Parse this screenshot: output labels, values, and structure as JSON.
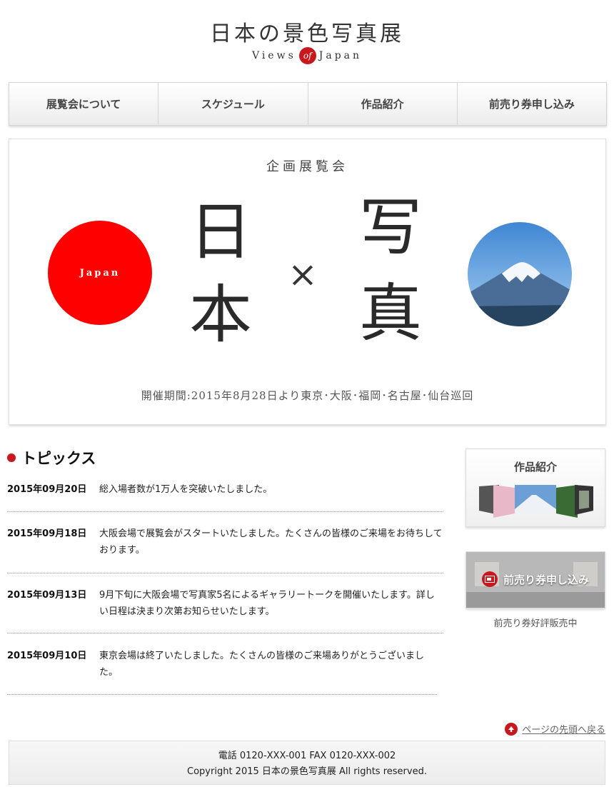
{
  "header": {
    "title": "日本の景色写真展",
    "subtitle_left": "Views",
    "subtitle_of": "of",
    "subtitle_right": "Japan"
  },
  "nav": {
    "items": [
      "展覧会について",
      "スケジュール",
      "作品紹介",
      "前売り券申し込み"
    ]
  },
  "hero": {
    "kicker": "企画展覧会",
    "circle_label": "Japan",
    "char1": "日",
    "char2": "本",
    "times": "×",
    "char3": "写",
    "char4": "真",
    "period": "開催期間:2015年8月28日より東京･大阪･福岡･名古屋･仙台巡回",
    "accent_color": "#ff0000"
  },
  "topics": {
    "title": "トピックス",
    "items": [
      {
        "date": "2015年09月20日",
        "text": "総入場者数が1万人を突破いたしました。"
      },
      {
        "date": "2015年09月18日",
        "text": "大阪会場で展覧会がスタートいたしました。たくさんの皆様のご来場をお待ちしております。"
      },
      {
        "date": "2015年09月13日",
        "text": "9月下旬に大阪会場で写真家5名によるギャラリートークを開催いたします。詳しい日程は決まり次第お知らせいたします。"
      },
      {
        "date": "2015年09月10日",
        "text": "東京会場は終了いたしました。たくさんの皆様のご来場ありがとうございました。"
      }
    ]
  },
  "sidebar": {
    "works_title": "作品紹介",
    "ticket_label": "前売り券申し込み",
    "ticket_note": "前売り券好評販売中"
  },
  "pagetop": {
    "label": "ページの先頭へ戻る"
  },
  "footer": {
    "contact": "電話 0120-XXX-001 FAX 0120-XXX-002",
    "copyright": "Copyright 2015 日本の景色写真展 All rights reserved."
  },
  "icons": {
    "topic_bullet": "red-dot-icon",
    "ticket": "ticket-icon",
    "pagetop": "arrow-up-icon"
  }
}
